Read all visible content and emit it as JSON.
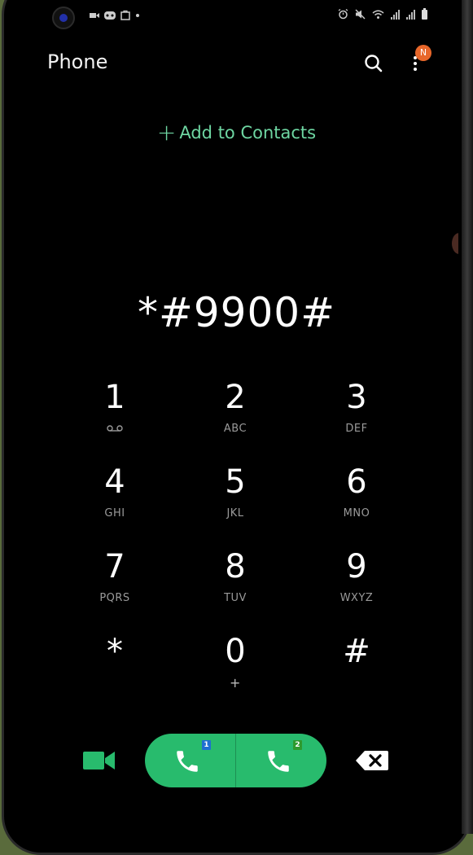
{
  "status_bar": {
    "icons_left": [
      "camera-cutout",
      "video-icon",
      "game-icon",
      "bag-icon",
      "dot"
    ],
    "icons_right": [
      "alarm-icon",
      "mute-icon",
      "wifi-icon",
      "signal-icon",
      "signal-icon",
      "battery-icon"
    ]
  },
  "header": {
    "title": "Phone",
    "notification_badge": "N"
  },
  "add_contacts": {
    "plus": "+",
    "label": "Add to Contacts"
  },
  "dialed_number": "*#9900#",
  "keypad": [
    {
      "digit": "1",
      "letters": ""
    },
    {
      "digit": "2",
      "letters": "ABC"
    },
    {
      "digit": "3",
      "letters": "DEF"
    },
    {
      "digit": "4",
      "letters": "GHI"
    },
    {
      "digit": "5",
      "letters": "JKL"
    },
    {
      "digit": "6",
      "letters": "MNO"
    },
    {
      "digit": "7",
      "letters": "PQRS"
    },
    {
      "digit": "8",
      "letters": "TUV"
    },
    {
      "digit": "9",
      "letters": "WXYZ"
    },
    {
      "digit": "*",
      "letters": ""
    },
    {
      "digit": "0",
      "letters": "+"
    },
    {
      "digit": "#",
      "letters": ""
    }
  ],
  "call_buttons": {
    "sim1_label": "1",
    "sim2_label": "2"
  },
  "colors": {
    "accent_green": "#28bb6d",
    "add_contacts_green": "#6ed6a2",
    "sim1_badge": "#1e6fd0",
    "sim2_badge": "#2e9a2e",
    "badge_orange": "#e8672a"
  }
}
